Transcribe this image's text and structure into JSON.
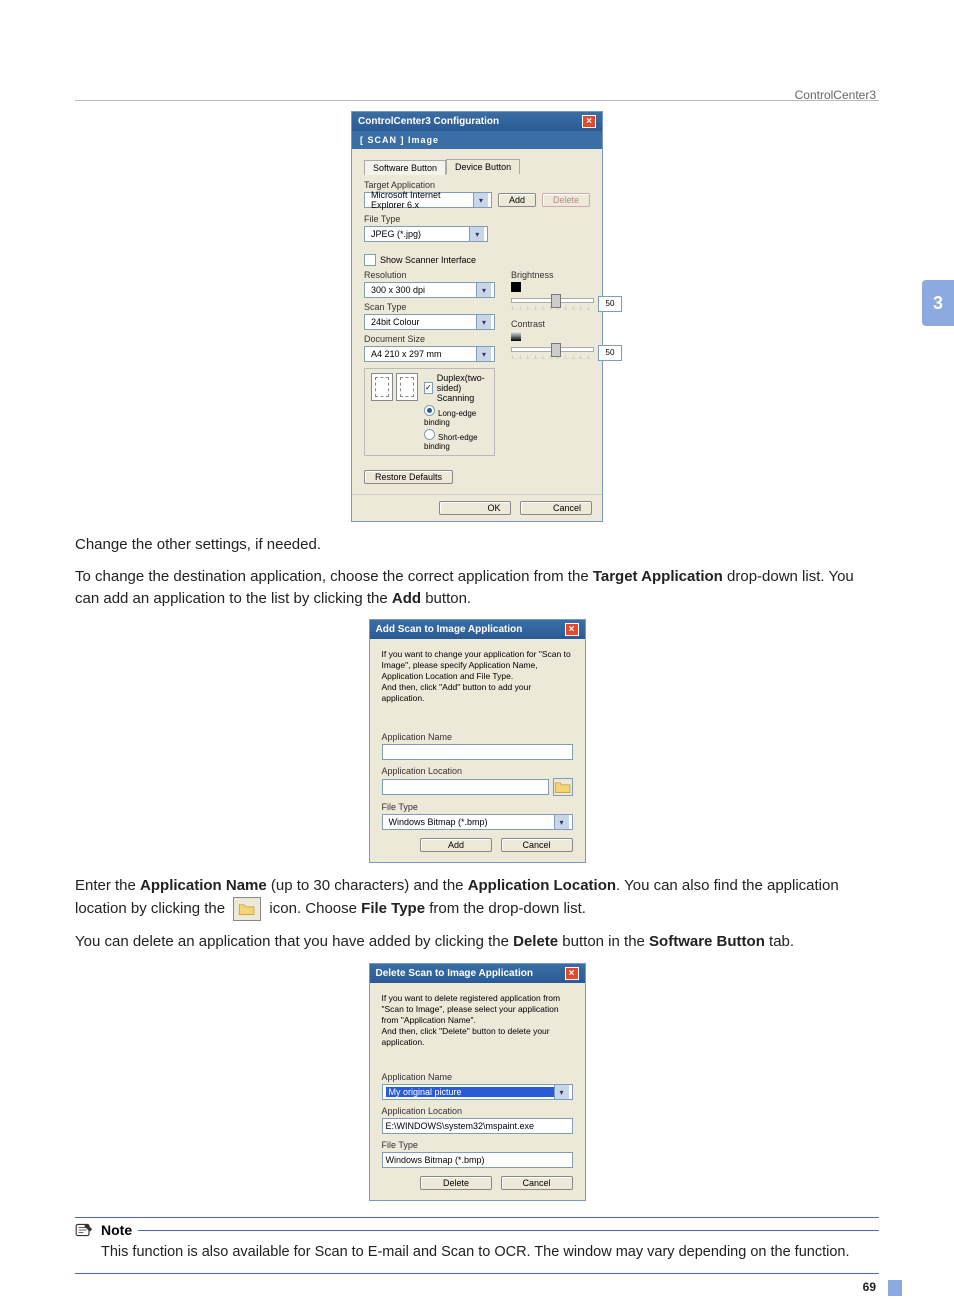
{
  "header": {
    "product": "ControlCenter3"
  },
  "chapter": {
    "number": "3"
  },
  "pagenum": "69",
  "paragraphs": {
    "p1": "Change the other settings, if needed.",
    "p2_a": "To change the destination application, choose the correct application from the ",
    "p2_b": "Target Application",
    "p2_c": " drop-down list. You can add an application to the list by clicking the ",
    "p2_d": "Add",
    "p2_e": " button.",
    "p3_a": "Enter the ",
    "p3_b": "Application Name",
    "p3_c": " (up to 30 characters) and the ",
    "p3_d": "Application Location",
    "p3_e": ". You can also find the application location by clicking the ",
    "p3_f": " icon. Choose ",
    "p3_g": "File Type",
    "p3_h": " from the drop-down list.",
    "p4_a": "You can delete an application that you have added by clicking the ",
    "p4_b": "Delete",
    "p4_c": " button in the ",
    "p4_d": "Software Button",
    "p4_e": " tab."
  },
  "note": {
    "title": "Note",
    "text": "This function is also available for Scan to E-mail and Scan to OCR. The window may vary depending on the function."
  },
  "dlg_config": {
    "title": "ControlCenter3 Configuration",
    "subbar": "[  SCAN  ]   Image",
    "tabs": {
      "software": "Software Button",
      "device": "Device Button"
    },
    "labels": {
      "target_app": "Target Application",
      "file_type": "File Type",
      "show_interface": "Show Scanner Interface",
      "resolution": "Resolution",
      "scan_type": "Scan Type",
      "doc_size": "Document Size",
      "brightness": "Brightness",
      "contrast": "Contrast",
      "duplex": "Duplex(two-sided) Scanning",
      "long_edge": "Long-edge binding",
      "short_edge": "Short-edge binding",
      "restore": "Restore Defaults"
    },
    "values": {
      "target_app": "Microsoft Internet Explorer 6.x",
      "file_type": "JPEG (*.jpg)",
      "resolution": "300 x 300 dpi",
      "scan_type": "24bit Colour",
      "doc_size": "A4 210 x 297 mm",
      "brightness": "50",
      "contrast": "50"
    },
    "buttons": {
      "add": "Add",
      "delete": "Delete",
      "ok": "OK",
      "cancel": "Cancel"
    }
  },
  "dlg_add": {
    "title": "Add Scan to Image Application",
    "instruction": "If you want to change your application for \"Scan to Image\", please specify Application Name, Application Location and File Type.\nAnd then, click \"Add\" button to add your application.",
    "labels": {
      "app_name": "Application Name",
      "app_location": "Application Location",
      "file_type": "File Type"
    },
    "values": {
      "file_type": "Windows Bitmap (*.bmp)"
    },
    "buttons": {
      "add": "Add",
      "cancel": "Cancel"
    }
  },
  "dlg_delete": {
    "title": "Delete Scan to Image Application",
    "instruction": "If you want to delete registered application from \"Scan to Image\", please select your application from \"Application Name\".\nAnd then, click \"Delete\" button to delete your application.",
    "labels": {
      "app_name": "Application Name",
      "app_location": "Application Location",
      "file_type": "File Type"
    },
    "values": {
      "app_name": "My original picture",
      "app_location": "E:\\WINDOWS\\system32\\mspaint.exe",
      "file_type": "Windows Bitmap (*.bmp)"
    },
    "buttons": {
      "delete": "Delete",
      "cancel": "Cancel"
    }
  }
}
